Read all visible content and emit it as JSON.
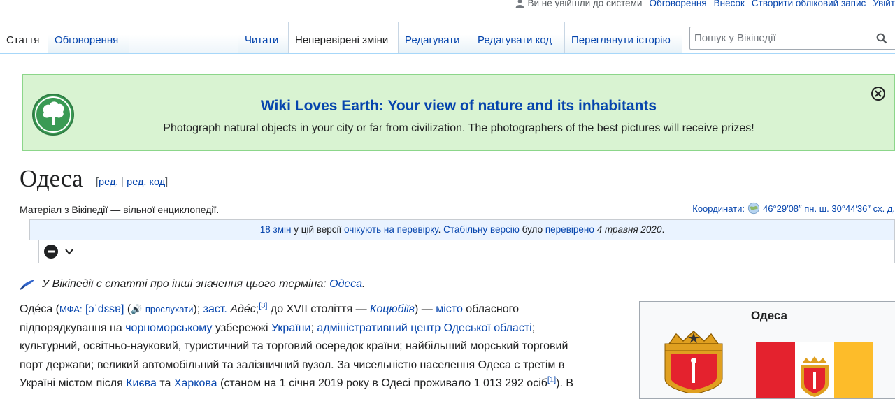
{
  "personal": {
    "not_logged": "Ви не увійшли до системи",
    "talk": "Обговорення",
    "contributions": "Внесок",
    "create_account": "Створити обліковий запис",
    "login": "Увійт"
  },
  "tabs": {
    "article": "Стаття",
    "talk": "Обговорення",
    "read": "Читати",
    "pending": "Неперевірені зміни",
    "edit": "Редагувати",
    "edit_source": "Редагувати код",
    "history": "Переглянути історію"
  },
  "search": {
    "placeholder": "Пошук у Вікіпедії"
  },
  "banner": {
    "title": "Wiki Loves Earth: Your view of nature and its inhabitants",
    "text": "Photograph natural objects in your city or far from civilization. The photographers of the best pictures will receive prizes!"
  },
  "page": {
    "title": "Одеса",
    "edit_open": "[",
    "edit": "ред.",
    "edit_source": "ред. код",
    "edit_close": "]",
    "tagline": "Матеріал з Вікіпедії — вільної енциклопедії.",
    "coords_label": "Координати:",
    "coords_value": "46°29′08″ пн. ш. 30°44′36″ сх. д."
  },
  "review": {
    "changes": "18 змін",
    "t1": " у цій версії ",
    "awaiting": "очікують на перевірку",
    "t2": ". ",
    "stable": "Стабільну версію",
    "t3": " було ",
    "checked": "перевірено",
    "date": " 4 травня 2020",
    "t4": "."
  },
  "hatnote": {
    "text": "У Вікіпедії є статті про інші значення цього терміна",
    "colon": ": ",
    "link": "Одеса",
    "dot": "."
  },
  "article": {
    "l1_a": "Оде́са (",
    "ipa_label": "МФА:",
    "ipa": "[ɔˈdɛsɐ]",
    "l1_b": " (",
    "listen": "прослухати",
    "l1_c": "); ",
    "obsolete": "заст.",
    "l1_d": " ",
    "ades": "Аде́с",
    "l1_e": ";",
    "ref3": "[3]",
    "l1_f": " до XVII століття — ",
    "kotsiubiiv": "Коцюбіїв",
    "l1_g": ") — ",
    "city": "місто",
    "l1_h": " обласного",
    "l2_a": "підпорядкування на ",
    "blacksea": "чорноморському",
    "l2_b": " узбережжі ",
    "ukraine": "України",
    "l2_c": "; ",
    "admin_center": "адміністративний центр Одеської області",
    "l2_d": ";",
    "l3": "культурний, освітньо-науковий, туристичний та торговий осередок країни; найбільший морський торговий",
    "l4": "порт держави; великий автомобільний та залізничний вузол. За чисельністю населення Одеса є третім в",
    "l5_a": "Україні містом після ",
    "kyiv": "Києва",
    "l5_b": " та ",
    "kharkiv": "Харкова",
    "l5_c": " (станом на 1 січня 2019 року в Одесі проживало 1 013 292 осіб",
    "ref1": "[1]",
    "l5_d": "). В"
  },
  "infobox": {
    "title": "Одеса"
  },
  "colors": {
    "link": "#0645ad",
    "banner_bg": "#d9f3d2",
    "banner_border": "#8cd68a",
    "review_bg": "#eaf3ff",
    "flag_red": "#e4222e",
    "flag_yellow": "#fdbc2a"
  }
}
